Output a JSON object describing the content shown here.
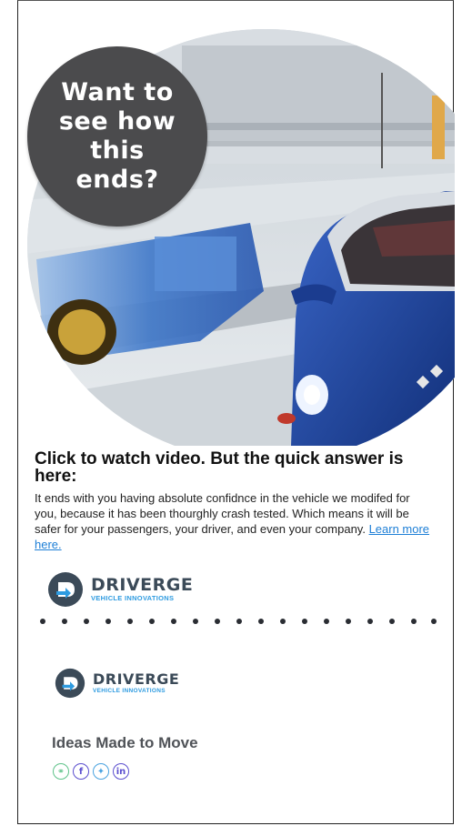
{
  "hero": {
    "bubble_text": "Want to see how this ends?",
    "image_description": "crash-test-video-still"
  },
  "content": {
    "headline": "Click to watch video. But the quick answer is here:",
    "body": "It ends with you having absolute confidnce in the vehicle we modifed for you, because it has been thourghly crash tested. Which means it will be safer for your passengers, your driver, and even your company. ",
    "link_text": "Learn more here."
  },
  "brand": {
    "name": "DRIVERGE",
    "tagline_small": "VEHICLE INNOVATIONS",
    "slogan": "Ideas Made to Move"
  },
  "social": [
    {
      "icon": "link-icon",
      "glyph": "⚭"
    },
    {
      "icon": "facebook-icon",
      "glyph": "f"
    },
    {
      "icon": "twitter-icon",
      "glyph": "✦"
    },
    {
      "icon": "linkedin-icon",
      "glyph": "in"
    }
  ],
  "colors": {
    "bubble": "#4b4b4d",
    "link": "#1e7fd6",
    "brand_dark": "#3b4a58",
    "brand_accent": "#2e9be0",
    "social": "#5b4fcf"
  }
}
